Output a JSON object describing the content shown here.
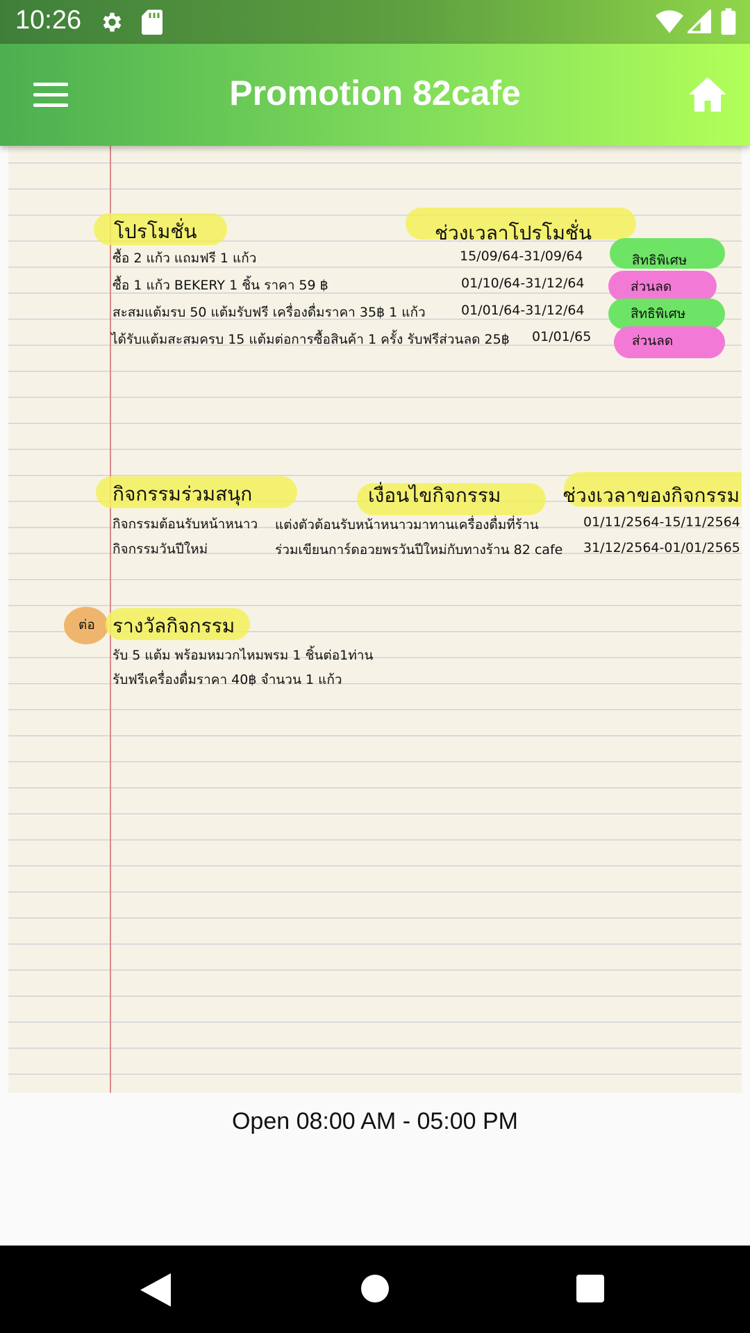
{
  "status_bar": {
    "time": "10:26",
    "icons": [
      "gear-icon",
      "sd-card-icon",
      "wifi-icon",
      "signal-icon",
      "battery-icon"
    ]
  },
  "app_bar": {
    "title": "Promotion 82cafe",
    "menu_icon": "hamburger-menu-icon",
    "home_icon": "home-icon",
    "gradient_colors": [
      "#4caf50",
      "#b2ff59"
    ]
  },
  "promotions": {
    "heading": "โปรโมชั่น",
    "period_heading": "ช่วงเวลาโปรโมชั่น",
    "rows": [
      {
        "text": "ซื้อ 2 แก้ว แถมฟรี 1 แก้ว",
        "period": "15/09/64-31/09/64",
        "badge": "สิทธิพิเศษ",
        "badge_color": "#6de466"
      },
      {
        "text": "ซื้อ 1 แก้ว BEKERY 1 ชิ้น ราคา 59 ฿",
        "period": "01/10/64-31/12/64",
        "badge": "ส่วนลด",
        "badge_color": "#f27ad6"
      },
      {
        "text": "สะสมแต้มรบ 50 แต้มรับฟรี เครื่องดื่มราคา 35฿ 1 แก้ว",
        "period": "01/01/64-31/12/64",
        "badge": "สิทธิพิเศษ",
        "badge_color": "#6de466"
      },
      {
        "text": "ได้รับแต้มสะสมครบ 15 แต้มต่อการซื้อสินค้า 1 ครั้ง รับฟรีส่วนลด 25฿",
        "period": "01/01/65",
        "badge": "ส่วนลด",
        "badge_color": "#f27ad6"
      }
    ]
  },
  "activities": {
    "heading": "กิจกรรมร่วมสนุก",
    "condition_heading": "เงื่อนไขกิจกรรม",
    "period_heading": "ช่วงเวลาของกิจกรรม",
    "rows": [
      {
        "name": "กิจกรรมต้อนรับหน้าหนาว",
        "condition": "แต่งตัวต้อนรับหน้าหนาวมาทานเครื่องดื่มที่ร้าน",
        "period": "01/11/2564-15/11/2564"
      },
      {
        "name": "กิจกรรมวันปีใหม่",
        "condition": "ร่วมเขียนการ์ดอวยพรวันปีใหม่กับทางร้าน 82 cafe",
        "period": "31/12/2564-01/01/2565"
      }
    ]
  },
  "rewards": {
    "marker": "ต่อ",
    "heading": "รางวัลกิจกรรม",
    "rows": [
      "รับ 5 แต้ม พร้อมหมวกไหมพรม 1 ชิ้นต่อ1ท่าน",
      "รับฟรีเครื่องดื่มราคา 40฿ จำนวน 1 แก้ว"
    ]
  },
  "footer": {
    "hours": "Open  08:00 AM - 05:00 PM"
  },
  "nav_bar": {
    "icons": [
      "back-icon",
      "home-circle-icon",
      "recents-icon"
    ]
  }
}
